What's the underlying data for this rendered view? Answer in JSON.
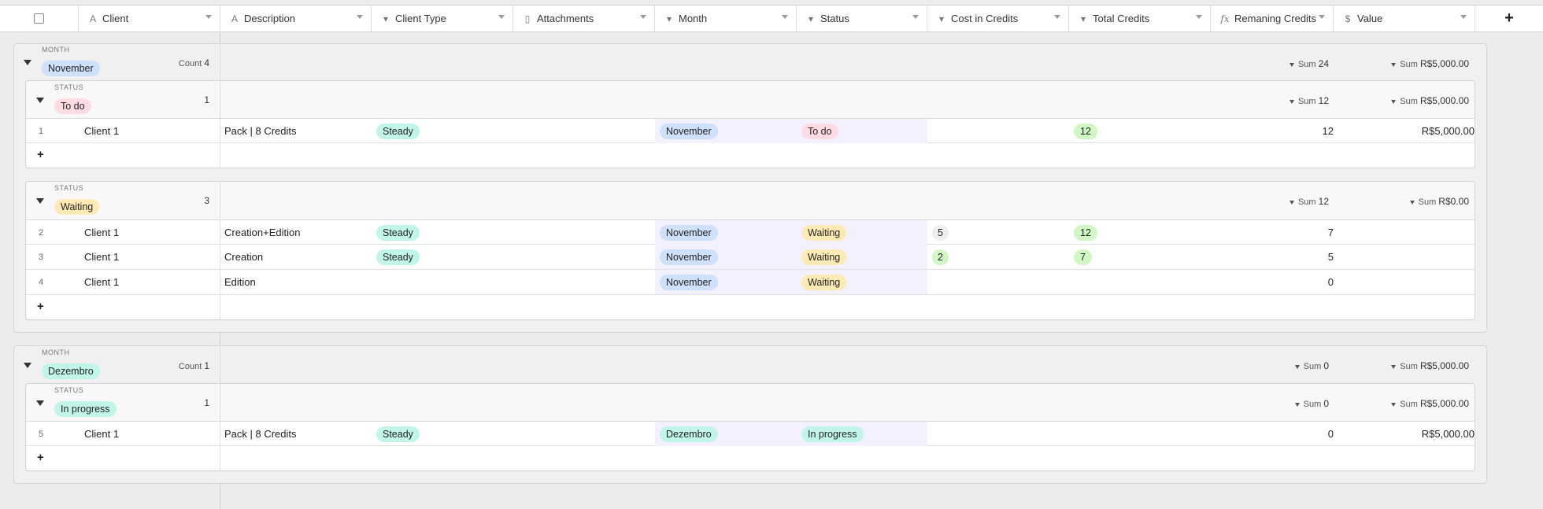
{
  "columns": [
    {
      "label": "Client",
      "icon": "A"
    },
    {
      "label": "Description",
      "icon": "A"
    },
    {
      "label": "Client Type",
      "icon": "▾"
    },
    {
      "label": "Attachments",
      "icon": "▯"
    },
    {
      "label": "Month",
      "icon": "▾"
    },
    {
      "label": "Status",
      "icon": "▾"
    },
    {
      "label": "Cost in Credits",
      "icon": "▾"
    },
    {
      "label": "Total Credits",
      "icon": "▾"
    },
    {
      "label": "Remaning Credits",
      "icon": "fx"
    },
    {
      "label": "Value",
      "icon": "$"
    }
  ],
  "add_column_label": "+",
  "groups": [
    {
      "field_label": "MONTH",
      "value": "November",
      "count_label": "Count",
      "count": "4",
      "sum_label": "Sum",
      "remaining_sum": "24",
      "value_sum": "R$5,000.00",
      "subgroups": [
        {
          "field_label": "STATUS",
          "value": "To do",
          "count": "1",
          "sum_label": "Sum",
          "remaining_sum": "12",
          "value_sum": "R$5,000.00",
          "rows": [
            {
              "num": "1",
              "client": "Client 1",
              "description": "Pack | 8 Credits",
              "client_type": "Steady",
              "month": "November",
              "status": "To do",
              "cost": "",
              "total": "12",
              "remaining": "12",
              "value": "R$5,000.00"
            }
          ]
        },
        {
          "field_label": "STATUS",
          "value": "Waiting",
          "count": "3",
          "sum_label": "Sum",
          "remaining_sum": "12",
          "value_sum": "R$0.00",
          "rows": [
            {
              "num": "2",
              "client": "Client 1",
              "description": "Creation+Edition",
              "client_type": "Steady",
              "month": "November",
              "status": "Waiting",
              "cost": "5",
              "total": "12",
              "remaining": "7",
              "value": ""
            },
            {
              "num": "3",
              "client": "Client 1",
              "description": "Creation",
              "client_type": "Steady",
              "month": "November",
              "status": "Waiting",
              "cost": "2",
              "total": "7",
              "remaining": "5",
              "value": ""
            },
            {
              "num": "4",
              "client": "Client 1",
              "description": "Edition",
              "client_type": "",
              "month": "November",
              "status": "Waiting",
              "cost": "",
              "total": "",
              "remaining": "0",
              "value": ""
            }
          ]
        }
      ]
    },
    {
      "field_label": "MONTH",
      "value": "Dezembro",
      "count_label": "Count",
      "count": "1",
      "sum_label": "Sum",
      "remaining_sum": "0",
      "value_sum": "R$5,000.00",
      "subgroups": [
        {
          "field_label": "STATUS",
          "value": "In progress",
          "count": "1",
          "sum_label": "Sum",
          "remaining_sum": "0",
          "value_sum": "R$5,000.00",
          "rows": [
            {
              "num": "5",
              "client": "Client 1",
              "description": "Pack | 8 Credits",
              "client_type": "Steady",
              "month": "Dezembro",
              "status": "In progress",
              "cost": "",
              "total": "",
              "remaining": "0",
              "value": "R$5,000.00"
            }
          ]
        }
      ]
    }
  ],
  "add_row_label": "+",
  "colors": {
    "month_pill": "#cfe0fc",
    "todo_pill": "#ffdce5",
    "waiting_pill": "#ffeab6",
    "inprogress_pill": "#c2f5e9",
    "steady_pill": "#c2f5e9",
    "cost_pill": "#eeeeee",
    "cost_green_pill": "#d1f7c4",
    "total_pill": "#d1f7c4",
    "month_cell_bg": "#f3f1fd"
  }
}
